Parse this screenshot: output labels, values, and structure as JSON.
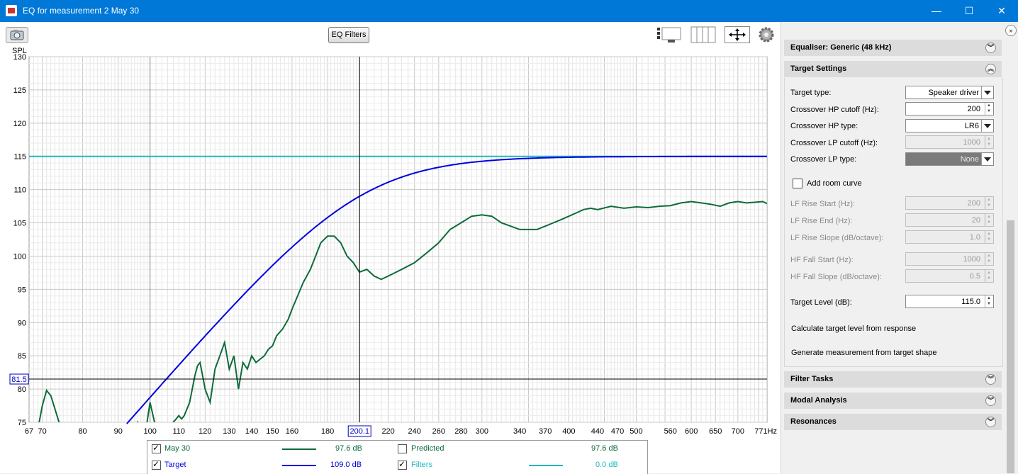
{
  "window": {
    "title": "EQ for measurement 2 May 30",
    "minimize": "—",
    "maximize": "☐",
    "close": "✕"
  },
  "toolbar": {
    "eq_filters_label": "EQ Filters"
  },
  "plot": {
    "y_axis_label": "SPL",
    "cursor_y_readout": "81.5",
    "cursor_x_readout": "200.1",
    "x_unit": "Hz"
  },
  "chart_data": {
    "type": "line",
    "title": "",
    "ylabel": "SPL",
    "xlabel": "Hz",
    "xscale": "log",
    "xlim": [
      67,
      771
    ],
    "ylim": [
      75,
      130
    ],
    "grid": true,
    "y_ticks": [
      "130",
      "125",
      "120",
      "115",
      "110",
      "105",
      "100",
      "95",
      "90",
      "85",
      "80",
      "75"
    ],
    "x_tick_labels": [
      "67",
      "70",
      "80",
      "90",
      "100",
      "110",
      "120",
      "130",
      "140",
      "150",
      "160",
      "180",
      "200.1",
      "220",
      "240",
      "260",
      "280",
      "300",
      "340",
      "370",
      "400",
      "440",
      "470",
      "500",
      "560",
      "600",
      "650",
      "700",
      "771Hz"
    ],
    "series": [
      {
        "name": "May 30",
        "color": "#0e6b3a",
        "x": [
          68,
          69,
          70,
          71,
          72,
          73,
          74,
          75,
          76,
          77,
          78,
          79,
          80,
          81,
          82,
          83,
          84,
          85,
          86,
          87,
          88,
          89,
          90,
          91,
          92,
          93,
          94,
          95,
          96,
          97,
          98,
          99,
          100,
          101,
          102,
          103,
          104,
          105,
          106,
          107,
          108,
          109,
          110,
          111,
          112,
          113,
          114,
          115,
          116,
          117,
          118,
          119,
          120,
          122,
          124,
          126,
          128,
          130,
          132,
          134,
          136,
          138,
          140,
          142,
          144,
          146,
          148,
          150,
          152,
          155,
          158,
          160,
          163,
          166,
          170,
          173,
          176,
          180,
          184,
          188,
          192,
          196,
          200,
          205,
          210,
          215,
          220,
          225,
          230,
          240,
          250,
          260,
          270,
          280,
          290,
          300,
          310,
          320,
          330,
          340,
          350,
          360,
          370,
          380,
          390,
          400,
          410,
          420,
          430,
          440,
          460,
          480,
          500,
          520,
          540,
          560,
          580,
          600,
          620,
          640,
          660,
          680,
          700,
          720,
          740,
          760,
          771
        ],
        "y": [
          72.5,
          74,
          77.5,
          79.8,
          79,
          77,
          75,
          73,
          71,
          70.5,
          70,
          69.5,
          69,
          68.5,
          68,
          67.5,
          67,
          66.5,
          66,
          65.5,
          65,
          65,
          65.2,
          65.6,
          66,
          66.5,
          70,
          74,
          75,
          74,
          72,
          75,
          78,
          76,
          74,
          73,
          72,
          71.5,
          72,
          74,
          75,
          75.5,
          76,
          75.5,
          76,
          77,
          78,
          80,
          82,
          83.5,
          84,
          82,
          80,
          78,
          83,
          85,
          87,
          83,
          85,
          80,
          84,
          83,
          85,
          84,
          84.5,
          85,
          86,
          86.5,
          88,
          89,
          90.5,
          92,
          94,
          96,
          98,
          100,
          102,
          103,
          103,
          102,
          100,
          99,
          97.6,
          98,
          97,
          96.5,
          97,
          97.5,
          98,
          99,
          100.5,
          102,
          104,
          105,
          106,
          106.2,
          106,
          105,
          104.5,
          104,
          104,
          104,
          104.5,
          105,
          105.5,
          106,
          106.5,
          107,
          107.2,
          107,
          107.5,
          107.2,
          107.4,
          107.3,
          107.5,
          107.6,
          108,
          108.2,
          108,
          107.8,
          107.5,
          108,
          108.2,
          108,
          108.1,
          108.2,
          107.9
        ]
      },
      {
        "name": "Target",
        "color": "#0000e0"
      },
      {
        "name": "Filters",
        "color": "#1fb9c0",
        "y": [
          115,
          115
        ]
      }
    ],
    "target_level": 115.0,
    "crossover_hp_hz": 200
  },
  "legend": [
    {
      "name": "May 30",
      "checked": true,
      "value": "97.6 dB",
      "color": "#0e6b3a"
    },
    {
      "name": "Target",
      "checked": true,
      "value": "109.0 dB",
      "color": "#0000e0"
    },
    {
      "name": "Predicted",
      "checked": false,
      "value": "97.6 dB",
      "color": "#0e6b3a"
    },
    {
      "name": "Filters",
      "checked": true,
      "value": "0.0 dB",
      "color": "#1fb9c0"
    }
  ],
  "sidebar": {
    "equaliser_header": "Equaliser: Generic (48 kHz)",
    "target_settings_header": "Target Settings",
    "target_type_label": "Target type:",
    "target_type_value": "Speaker driver",
    "hp_cutoff_label": "Crossover HP cutoff (Hz):",
    "hp_cutoff_value": "200",
    "hp_type_label": "Crossover HP type:",
    "hp_type_value": "LR6",
    "lp_cutoff_label": "Crossover LP cutoff (Hz):",
    "lp_cutoff_value": "1000",
    "lp_type_label": "Crossover LP type:",
    "lp_type_value": "None",
    "add_room_curve_label": "Add room curve",
    "lf_rise_start_label": "LF Rise Start (Hz):",
    "lf_rise_start_value": "200",
    "lf_rise_end_label": "LF Rise End (Hz):",
    "lf_rise_end_value": "20",
    "lf_rise_slope_label": "LF Rise Slope (dB/octave):",
    "lf_rise_slope_value": "1.0",
    "hf_fall_start_label": "HF Fall Start (Hz):",
    "hf_fall_start_value": "1000",
    "hf_fall_slope_label": "HF Fall Slope (dB/octave):",
    "hf_fall_slope_value": "0.5",
    "target_level_label": "Target Level (dB):",
    "target_level_value": "115.0",
    "calc_target_label": "Calculate target level from response",
    "generate_measurement_label": "Generate measurement from target shape",
    "filter_tasks_header": "Filter Tasks",
    "modal_analysis_header": "Modal Analysis",
    "resonances_header": "Resonances"
  }
}
